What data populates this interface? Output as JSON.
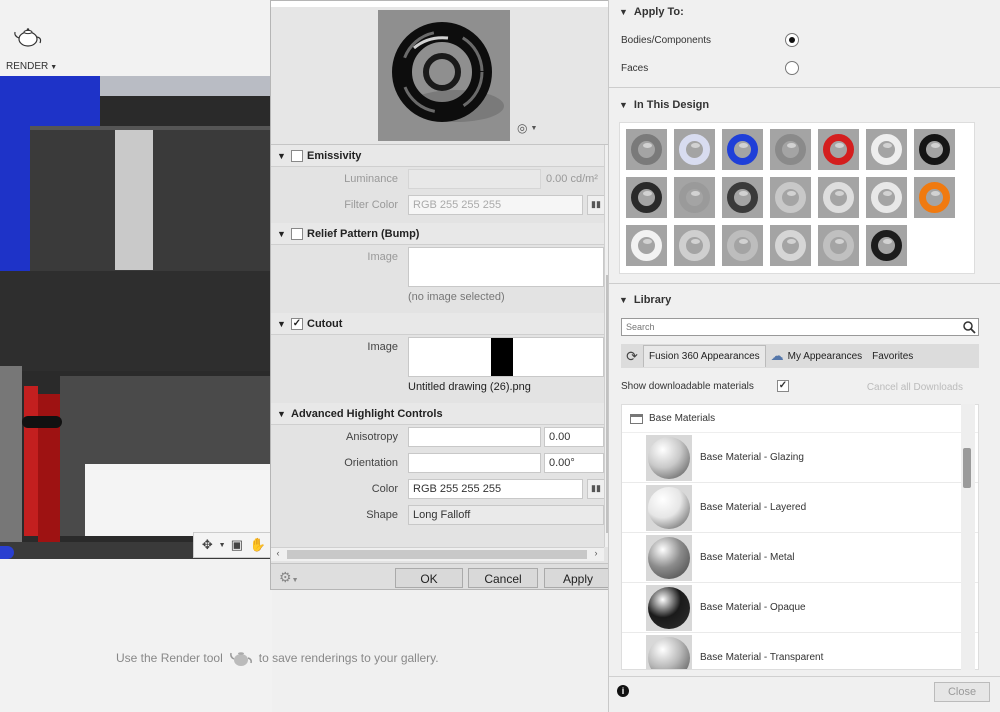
{
  "render": {
    "label": "RENDER",
    "gallery_msg_before": "Use the Render tool",
    "gallery_msg_after": "to save renderings to your gallery."
  },
  "editor": {
    "sections": {
      "emissivity": "Emissivity",
      "relief": "Relief Pattern (Bump)",
      "cutout": "Cutout",
      "highlight": "Advanced Highlight Controls"
    },
    "emissivity": {
      "luminance_label": "Luminance",
      "luminance_unit": "0.00 cd/m²",
      "filter_color_label": "Filter Color",
      "filter_color_value": "RGB 255 255 255"
    },
    "relief": {
      "image_label": "Image",
      "image_caption": "(no image selected)"
    },
    "cutout": {
      "checked": true,
      "image_label": "Image",
      "image_caption": "Untitled drawing (26).png"
    },
    "highlight": {
      "anisotropy_label": "Anisotropy",
      "anisotropy_value": "0.00",
      "orientation_label": "Orientation",
      "orientation_value": "0.00°",
      "color_label": "Color",
      "color_value": "RGB 255 255 255",
      "shape_label": "Shape",
      "shape_value": "Long Falloff"
    },
    "buttons": {
      "ok": "OK",
      "cancel": "Cancel",
      "apply": "Apply"
    }
  },
  "panel": {
    "apply_to": {
      "title": "Apply To:",
      "options": [
        {
          "label": "Bodies/Components",
          "selected": true
        },
        {
          "label": "Faces",
          "selected": false
        }
      ]
    },
    "in_this_design": {
      "title": "In This Design",
      "swatches": [
        "#7a7a7a",
        "#d8dcf0",
        "#1f3fd8",
        "#8a8a8a",
        "#d41e1e",
        "#eeeeee",
        "#151515",
        "#2a2a2a",
        "#9a9a9a",
        "#3a3a3a",
        "#c8c8c8",
        "#dedede",
        "#e8e8e8",
        "#f07a10",
        "#f2f2f2",
        "#cfcfcf",
        "#bdbdbd",
        "#d6d6d6",
        "#c0c0c0",
        "#1c1c1c"
      ]
    },
    "library": {
      "title": "Library",
      "search_placeholder": "Search",
      "tabs": [
        "Fusion 360 Appearances",
        "My Appearances",
        "Favorites"
      ],
      "show_downloadable": "Show downloadable materials",
      "cancel_downloads": "Cancel all Downloads",
      "folder": "Base Materials",
      "materials": [
        {
          "name": "Base Material - Glazing",
          "color": "#c9c9c9"
        },
        {
          "name": "Base Material - Layered",
          "color": "#e6e6e6"
        },
        {
          "name": "Base Material - Metal",
          "color": "#8c8c8c"
        },
        {
          "name": "Base Material - Opaque",
          "color": "#1a1a1a"
        },
        {
          "name": "Base Material - Transparent",
          "color": "#b9b9b9"
        }
      ]
    },
    "close": "Close"
  }
}
